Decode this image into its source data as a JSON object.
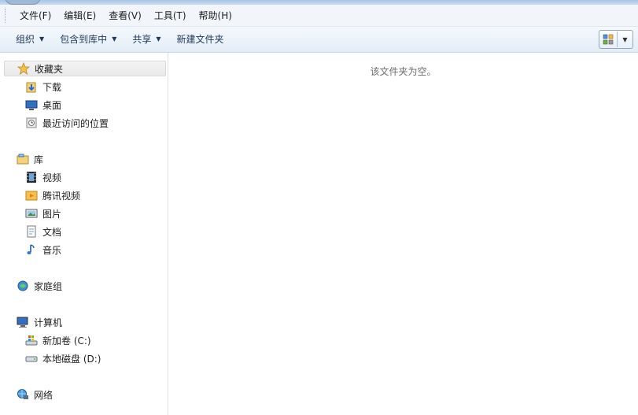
{
  "menu": {
    "items": [
      "文件(F)",
      "编辑(E)",
      "查看(V)",
      "工具(T)",
      "帮助(H)"
    ]
  },
  "toolbar": {
    "organize": "组织",
    "include_in_library": "包含到库中",
    "share": "共享",
    "new_folder": "新建文件夹"
  },
  "nav": {
    "favorites": {
      "label": "收藏夹",
      "items": [
        "下载",
        "桌面",
        "最近访问的位置"
      ]
    },
    "libraries": {
      "label": "库",
      "items": [
        "视频",
        "腾讯视频",
        "图片",
        "文档",
        "音乐"
      ]
    },
    "homegroup": {
      "label": "家庭组"
    },
    "computer": {
      "label": "计算机",
      "items": [
        "新加卷 (C:)",
        "本地磁盘 (D:)"
      ]
    },
    "network": {
      "label": "网络"
    }
  },
  "content": {
    "empty_message": "该文件夹为空。"
  },
  "colors": {
    "toolbar_text": "#1e395b",
    "accent": "#3a7bd5"
  }
}
